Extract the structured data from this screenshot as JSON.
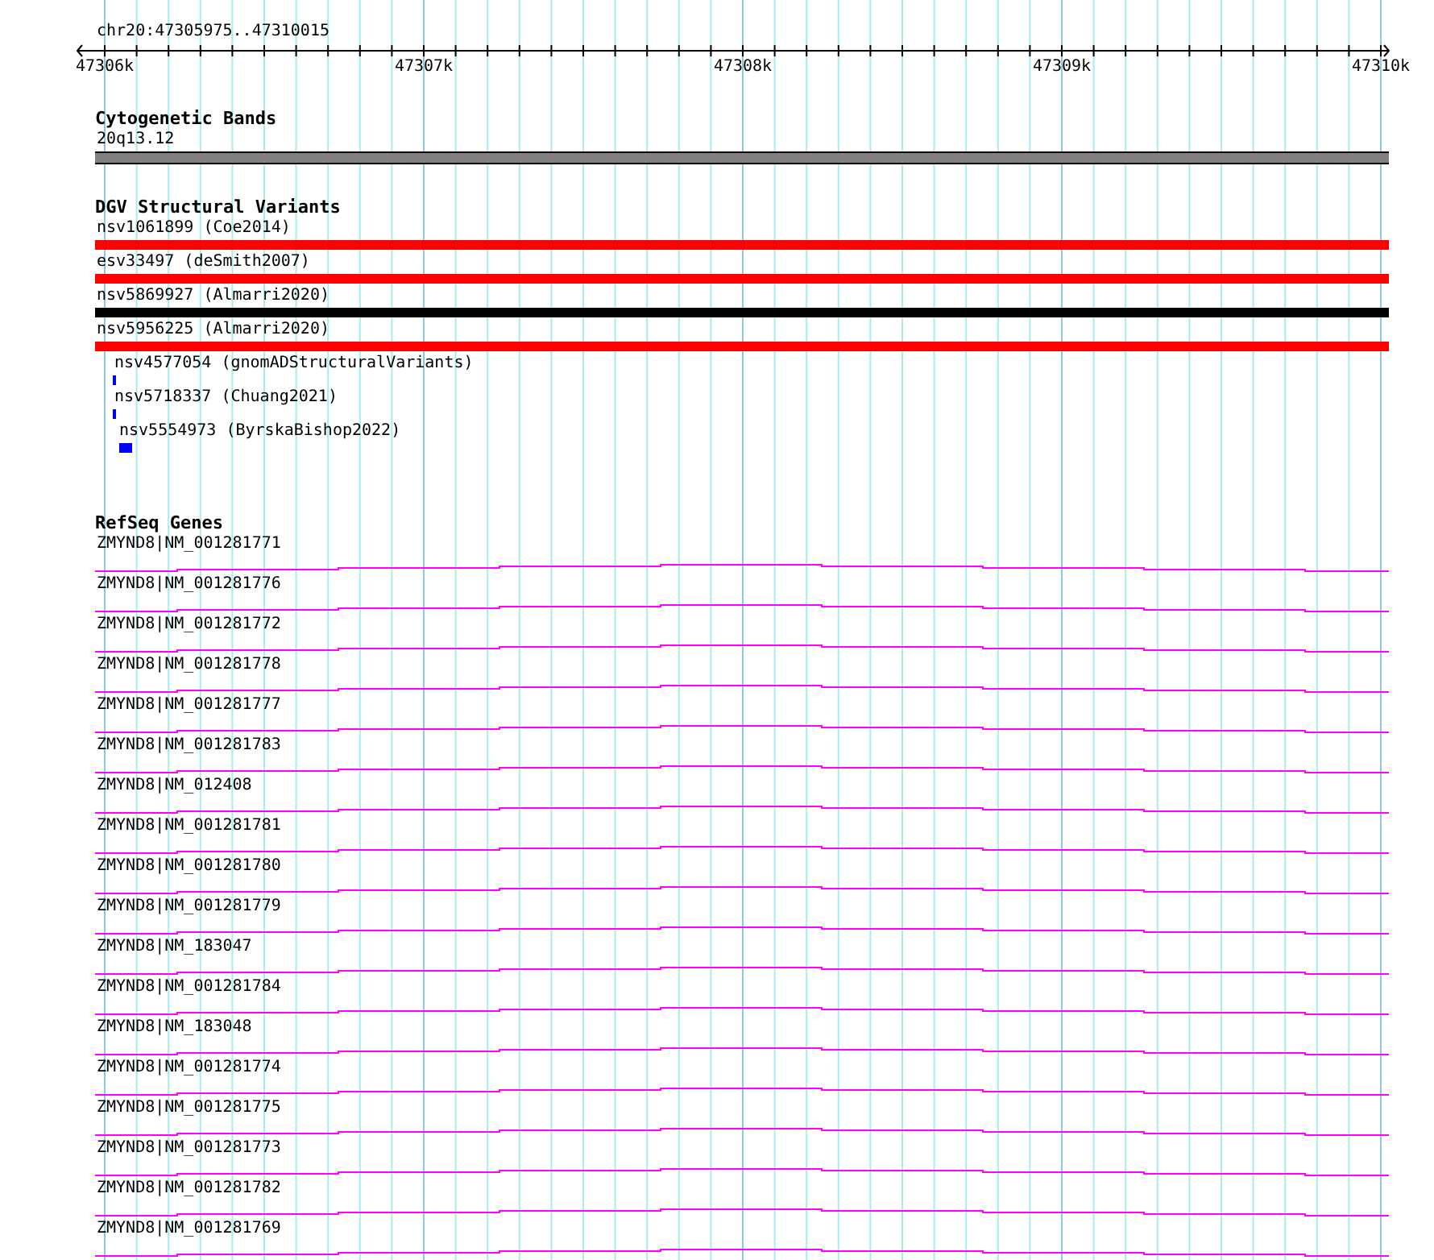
{
  "location": "chr20:47305975..47310015",
  "ruler": {
    "labels": [
      "47306k",
      "47307k",
      "47308k",
      "47309k",
      "47310k"
    ]
  },
  "tracks": [
    {
      "kind": "cytoband",
      "title": "Cytogenetic Bands",
      "features": [
        {
          "label": "20q13.12",
          "color": "#808080"
        }
      ]
    },
    {
      "kind": "variants",
      "title": "DGV Structural Variants",
      "features": [
        {
          "kind": "span",
          "label": "nsv1061899 (Coe2014)",
          "color": "#ff0000"
        },
        {
          "kind": "span",
          "label": "esv33497 (deSmith2007)",
          "color": "#ff0000"
        },
        {
          "kind": "span",
          "label": "nsv5869927 (Almarri2020)",
          "color": "#000000"
        },
        {
          "kind": "span",
          "label": "nsv5956225 (Almarri2020)",
          "color": "#ff0000"
        },
        {
          "kind": "tick",
          "label": "nsv4577054 (gnomADStructuralVariants)",
          "color": "#0000ff"
        },
        {
          "kind": "tick",
          "label": "nsv5718337 (Chuang2021)",
          "color": "#0000ff"
        },
        {
          "kind": "block",
          "label": "nsv5554973 (ByrskaBishop2022)",
          "color": "#0000ff"
        }
      ]
    },
    {
      "kind": "genes",
      "title": "RefSeq Genes",
      "features": [
        {
          "label": "ZMYND8|NM_001281771"
        },
        {
          "label": "ZMYND8|NM_001281776"
        },
        {
          "label": "ZMYND8|NM_001281772"
        },
        {
          "label": "ZMYND8|NM_001281778"
        },
        {
          "label": "ZMYND8|NM_001281777"
        },
        {
          "label": "ZMYND8|NM_001281783"
        },
        {
          "label": "ZMYND8|NM_012408"
        },
        {
          "label": "ZMYND8|NM_001281781"
        },
        {
          "label": "ZMYND8|NM_001281780"
        },
        {
          "label": "ZMYND8|NM_001281779"
        },
        {
          "label": "ZMYND8|NM_183047"
        },
        {
          "label": "ZMYND8|NM_001281784"
        },
        {
          "label": "ZMYND8|NM_183048"
        },
        {
          "label": "ZMYND8|NM_001281774"
        },
        {
          "label": "ZMYND8|NM_001281775"
        },
        {
          "label": "ZMYND8|NM_001281773"
        },
        {
          "label": "ZMYND8|NM_001281782"
        },
        {
          "label": "ZMYND8|NM_001281769"
        }
      ]
    }
  ]
}
